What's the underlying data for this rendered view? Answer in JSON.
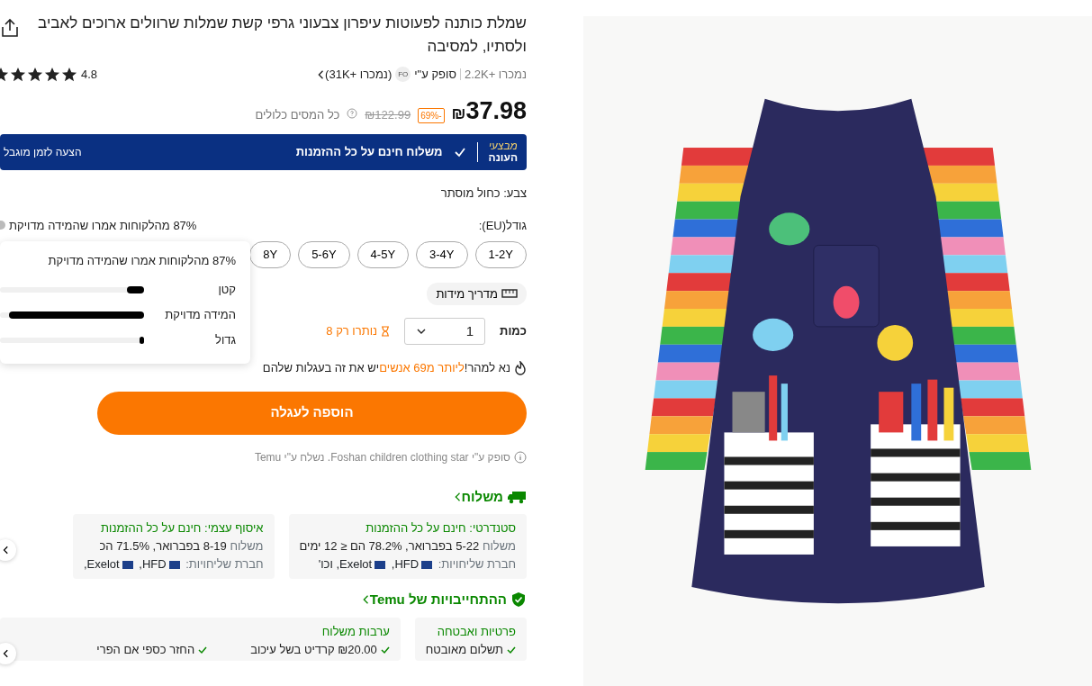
{
  "product": {
    "title": "שמלת כותנה לפעוטות עיפרון צבעוני גרפי קשת שמלות שרוולים ארוכים לאביב ולסתיו, למסיבה",
    "sold": "נמכרו +2.2K",
    "seller_prefix": "סופק ע\"י",
    "seller_badge": "FO",
    "seller_sold": "(נמכרו +31K)",
    "rating": "4.8",
    "stars": 5
  },
  "price": {
    "currency": "₪",
    "amount": "37.98",
    "discount": "-69%",
    "original": "₪122.99",
    "tax_note": "כל המסים כלולים"
  },
  "banner": {
    "logo": [
      "מבצעי",
      "העונה"
    ],
    "offer": "משלוח חינם על כל ההזמנות",
    "note": "הצעה לזמן מוגבל"
  },
  "color_label": "צבע: כחול מוסתר",
  "size": {
    "label": "גודל(EU):",
    "fit_note": "87% מהלקוחות אמרו שהמידה מדויקת",
    "options": [
      {
        "label": "1-2Y",
        "selected": false
      },
      {
        "label": "3-4Y",
        "selected": false
      },
      {
        "label": "4-5Y",
        "selected": false
      },
      {
        "label": "5-6Y",
        "selected": false
      },
      {
        "label": "8Y",
        "selected": false
      }
    ],
    "guide": "מדריך מידות"
  },
  "tooltip": {
    "title": "87% מהלקוחות אמרו שהמידה מדויקת",
    "rows": [
      {
        "label": "קטן",
        "level": 0.12
      },
      {
        "label": "המידה מדויקת",
        "level": 0.94
      },
      {
        "label": "גדול",
        "level": 0.03
      }
    ]
  },
  "quantity": {
    "label": "כמות",
    "value": "1",
    "stock": "נותרו רק 8"
  },
  "urgency": [
    {
      "kind": "plain",
      "text": "נא למהר!"
    },
    {
      "kind": "highlight",
      "text": "ליותר מ69 אנשים"
    },
    {
      "kind": "plain",
      "text": "יש את זה בעגלות שלהם"
    }
  ],
  "add_to_cart": "הוספה לעגלה",
  "supplier_note": "סופק ע\"י Foshan children clothing star. נשלח ע\"י Temu",
  "shipping": {
    "title": "משלוח",
    "options": [
      {
        "title": "סטנדרטי: חינם על כל ההזמנות",
        "eta_label": "משלוח",
        "eta": "5-22 בפברואר, 78.2% הם ≤ 12 ימים",
        "carriers_label": "חברת שליחויות:",
        "carriers": [
          "HFD,",
          "Exelot, וכו'"
        ]
      },
      {
        "title": "איסוף עצמי: חינם על כל ההזמנות",
        "eta_label": "משלוח",
        "eta": "8-19 בפברואר, 71.5% הכ",
        "carriers_label": "חברת שליחויות:",
        "carriers": [
          "HFD,",
          "Exelot,"
        ]
      }
    ]
  },
  "commitments": {
    "title": "ההתחייבויות של Temu",
    "cards": [
      {
        "title": "פרטיות ואבטחה",
        "items": [
          "תשלום מאובטח"
        ]
      },
      {
        "title": "ערבות משלוח",
        "items": [
          "₪20.00 קרדיט בשל עיכוב",
          "החזר כספי אם הפרי"
        ]
      }
    ]
  }
}
